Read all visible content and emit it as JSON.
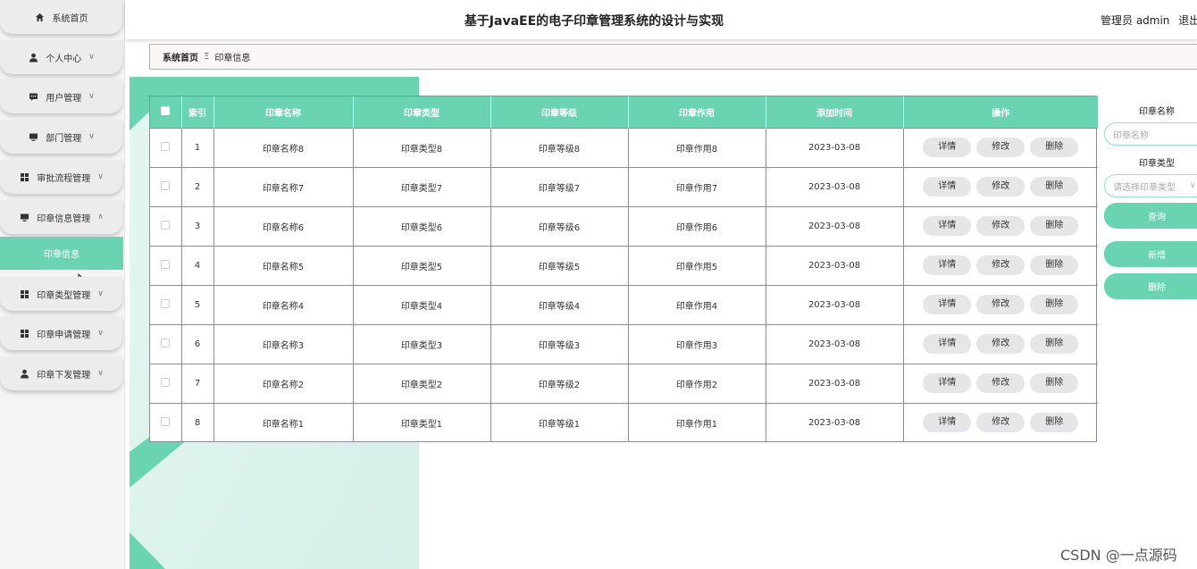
{
  "sidebar": {
    "items": [
      {
        "label": "系统首页",
        "icon": "home-icon",
        "has_arrow": false
      },
      {
        "label": "个人中心",
        "icon": "user-icon",
        "has_arrow": true
      },
      {
        "label": "用户管理",
        "icon": "chat-icon",
        "has_arrow": true
      },
      {
        "label": "部门管理",
        "icon": "monitor-icon",
        "has_arrow": true
      },
      {
        "label": "审批流程管理",
        "icon": "grid-icon",
        "has_arrow": true
      },
      {
        "label": "印章信息管理",
        "icon": "monitor-icon",
        "has_arrow": true,
        "expanded": true
      },
      {
        "label": "印章类型管理",
        "icon": "grid-icon",
        "has_arrow": true
      },
      {
        "label": "印章申请管理",
        "icon": "grid-icon",
        "has_arrow": true
      },
      {
        "label": "印章下发管理",
        "icon": "user-icon",
        "has_arrow": true
      }
    ],
    "active_sub": "印章信息"
  },
  "header": {
    "title": "基于JavaEE的电子印章管理系统的设计与实现",
    "user_text": "管理员 admin",
    "logout": "退出登录"
  },
  "breadcrumb": {
    "home": "系统首页",
    "separator": "Ξ",
    "current": "印章信息"
  },
  "table": {
    "columns": [
      "索引",
      "印章名称",
      "印章类型",
      "印章等级",
      "印章作用",
      "添加时间",
      "操作"
    ],
    "actions": [
      "详情",
      "修改",
      "删除"
    ],
    "rows": [
      {
        "index": "1",
        "name": "印章名称8",
        "type": "印章类型8",
        "level": "印章等级8",
        "usage": "印章作用8",
        "time": "2023-03-08"
      },
      {
        "index": "2",
        "name": "印章名称7",
        "type": "印章类型7",
        "level": "印章等级7",
        "usage": "印章作用7",
        "time": "2023-03-08"
      },
      {
        "index": "3",
        "name": "印章名称6",
        "type": "印章类型6",
        "level": "印章等级6",
        "usage": "印章作用6",
        "time": "2023-03-08"
      },
      {
        "index": "4",
        "name": "印章名称5",
        "type": "印章类型5",
        "level": "印章等级5",
        "usage": "印章作用5",
        "time": "2023-03-08"
      },
      {
        "index": "5",
        "name": "印章名称4",
        "type": "印章类型4",
        "level": "印章等级4",
        "usage": "印章作用4",
        "time": "2023-03-08"
      },
      {
        "index": "6",
        "name": "印章名称3",
        "type": "印章类型3",
        "level": "印章等级3",
        "usage": "印章作用3",
        "time": "2023-03-08"
      },
      {
        "index": "7",
        "name": "印章名称2",
        "type": "印章类型2",
        "level": "印章等级2",
        "usage": "印章作用2",
        "time": "2023-03-08"
      },
      {
        "index": "8",
        "name": "印章名称1",
        "type": "印章类型1",
        "level": "印章等级1",
        "usage": "印章作用1",
        "time": "2023-03-08"
      }
    ]
  },
  "search": {
    "name_label": "印章名称",
    "name_placeholder": "印章名称",
    "type_label": "印章类型",
    "type_placeholder": "请选择印章类型",
    "query_button": "查询",
    "add_button": "新增",
    "delete_button": "删除"
  },
  "watermark": "CSDN @一点源码",
  "colors": {
    "accent": "#6ad3b2",
    "button_gray": "#e6e6e6"
  }
}
